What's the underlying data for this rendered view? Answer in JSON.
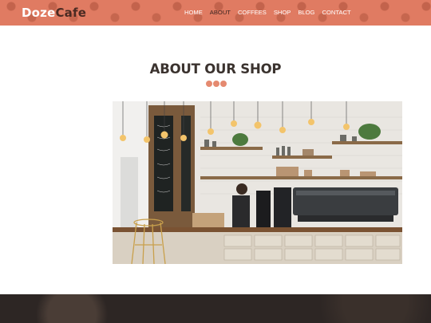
{
  "brand": {
    "part1": "Doze",
    "part2": "Cafe"
  },
  "nav": {
    "items": [
      "HOME",
      "ABOUT",
      "COFFEES",
      "SHOP",
      "BLOG",
      "CONTACT"
    ],
    "active": "ABOUT"
  },
  "about": {
    "title": "ABOUT OUR SHOP"
  },
  "colors": {
    "nav_bg": "#e07b62",
    "accent": "#e58a70",
    "heading": "#3b332f",
    "footer": "#2d2624"
  }
}
